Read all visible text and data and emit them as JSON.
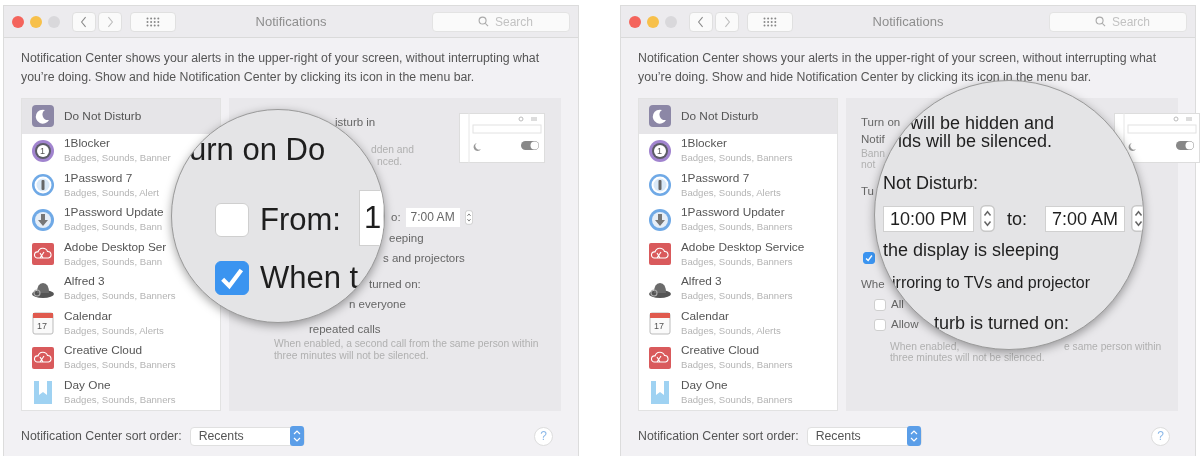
{
  "windows": [
    {
      "title": "Notifications",
      "search_placeholder": "Search",
      "description": "Notification Center shows your alerts in the upper-right of your screen, without interrupting what you’re doing. Show and hide Notification Center by clicking its icon in the menu bar.",
      "apps": [
        {
          "kind": "moon",
          "name": "Do Not Disturb",
          "selected": true
        },
        {
          "kind": "ring",
          "name": "1Blocker",
          "detail": "Badges, Sounds, Banner",
          "badge": "1",
          "selected": false
        },
        {
          "kind": "keyhole",
          "name": "1Password 7",
          "detail": "Badges, Sounds, Alert",
          "selected": false
        },
        {
          "kind": "download",
          "name": "1Password Update",
          "detail": "Badges, Sounds, Bann",
          "selected": false
        },
        {
          "kind": "cloud",
          "name": "Adobe Desktop Ser",
          "detail": "Badges, Sounds, Bann",
          "selected": false
        },
        {
          "kind": "hat",
          "name": "Alfred 3",
          "detail": "Badges, Sounds, Banners",
          "selected": false
        },
        {
          "kind": "calendar",
          "name": "Calendar",
          "detail": "Badges, Sounds, Alerts",
          "badge": "17",
          "selected": false
        },
        {
          "kind": "cloud",
          "name": "Creative Cloud",
          "detail": "Badges, Sounds, Banners",
          "selected": false
        },
        {
          "kind": "bookmark",
          "name": "Day One",
          "detail": "Badges, Sounds, Banners",
          "selected": false
        }
      ],
      "panel": [
        {
          "kind": "text",
          "text": "isturb in"
        },
        {
          "kind": "note",
          "text": "dden and"
        },
        {
          "kind": "note",
          "text": "nced."
        },
        {
          "kind": "preview"
        },
        {
          "kind": "time",
          "label": "o:",
          "value": "7:00 AM"
        },
        {
          "kind": "text",
          "text": "eeping"
        },
        {
          "kind": "text",
          "text": "s and projectors"
        },
        {
          "kind": "text",
          "text": "turned on:"
        },
        {
          "kind": "text",
          "text": "n everyone"
        },
        {
          "kind": "text",
          "text": "repeated calls"
        },
        {
          "kind": "note",
          "text": "When enabled, a second call from the same person within three minutes will not be silenced."
        }
      ],
      "magnifier": [
        {
          "kind": "text",
          "text": "urn on Do"
        },
        {
          "kind": "checkbox",
          "checked": false,
          "text": "From:"
        },
        {
          "kind": "field",
          "value": "1"
        },
        {
          "kind": "checkbox",
          "checked": true,
          "text": "When t"
        }
      ],
      "sort_label": "Notification Center sort order:",
      "sort_value": "Recents",
      "help": "?"
    },
    {
      "title": "Notifications",
      "search_placeholder": "Search",
      "description": "Notification Center shows your alerts in the upper-right of your screen, without interrupting what you’re doing. Show and hide Notification Center by clicking its icon in the menu bar.",
      "apps": [
        {
          "kind": "moon",
          "name": "Do Not Disturb",
          "selected": true
        },
        {
          "kind": "ring",
          "name": "1Blocker",
          "detail": "Badges, Sounds, Banners",
          "badge": "1",
          "selected": false
        },
        {
          "kind": "keyhole",
          "name": "1Password 7",
          "detail": "Badges, Sounds, Alerts",
          "selected": false
        },
        {
          "kind": "download",
          "name": "1Password Updater",
          "detail": "Badges, Sounds, Banners",
          "selected": false
        },
        {
          "kind": "cloud",
          "name": "Adobe Desktop Service",
          "detail": "Badges, Sounds, Banners",
          "selected": false
        },
        {
          "kind": "hat",
          "name": "Alfred 3",
          "detail": "Badges, Sounds, Banners",
          "selected": false
        },
        {
          "kind": "calendar",
          "name": "Calendar",
          "detail": "Badges, Sounds, Alerts",
          "badge": "17",
          "selected": false
        },
        {
          "kind": "cloud",
          "name": "Creative Cloud",
          "detail": "Badges, Sounds, Banners",
          "selected": false
        },
        {
          "kind": "bookmark",
          "name": "Day One",
          "detail": "Badges, Sounds, Banners",
          "selected": false
        }
      ],
      "panel": [
        {
          "kind": "text",
          "text": "Turn on"
        },
        {
          "kind": "text",
          "text": "Notif"
        },
        {
          "kind": "note",
          "text": "Bann"
        },
        {
          "kind": "note",
          "text": "not"
        },
        {
          "kind": "preview"
        },
        {
          "kind": "text",
          "text": "Tu"
        },
        {
          "kind": "checkbox",
          "checked": true
        },
        {
          "kind": "text",
          "text": "Whe"
        },
        {
          "kind": "checkbox",
          "checked": false,
          "text": "All"
        },
        {
          "kind": "checkbox",
          "checked": false,
          "text": "Allow"
        },
        {
          "kind": "note",
          "text": "When enabled,"
        },
        {
          "kind": "note",
          "text": "e same person within"
        },
        {
          "kind": "note",
          "text": "three minutes will not be silenced."
        }
      ],
      "magnifier": [
        {
          "kind": "text",
          "text": "will be hidden and"
        },
        {
          "kind": "text",
          "text": "ids will be silenced."
        },
        {
          "kind": "text",
          "text": "Not Disturb:"
        },
        {
          "kind": "time",
          "value": "10:00 PM",
          "label": "to:",
          "end_value": "7:00 AM"
        },
        {
          "kind": "text",
          "text": "the display is sleeping"
        },
        {
          "kind": "text",
          "text": "irroring to TVs and projector"
        },
        {
          "kind": "text",
          "text": "turb is turned on:"
        }
      ],
      "sort_label": "Notification Center sort order:",
      "sort_value": "Recents",
      "help": "?"
    }
  ]
}
